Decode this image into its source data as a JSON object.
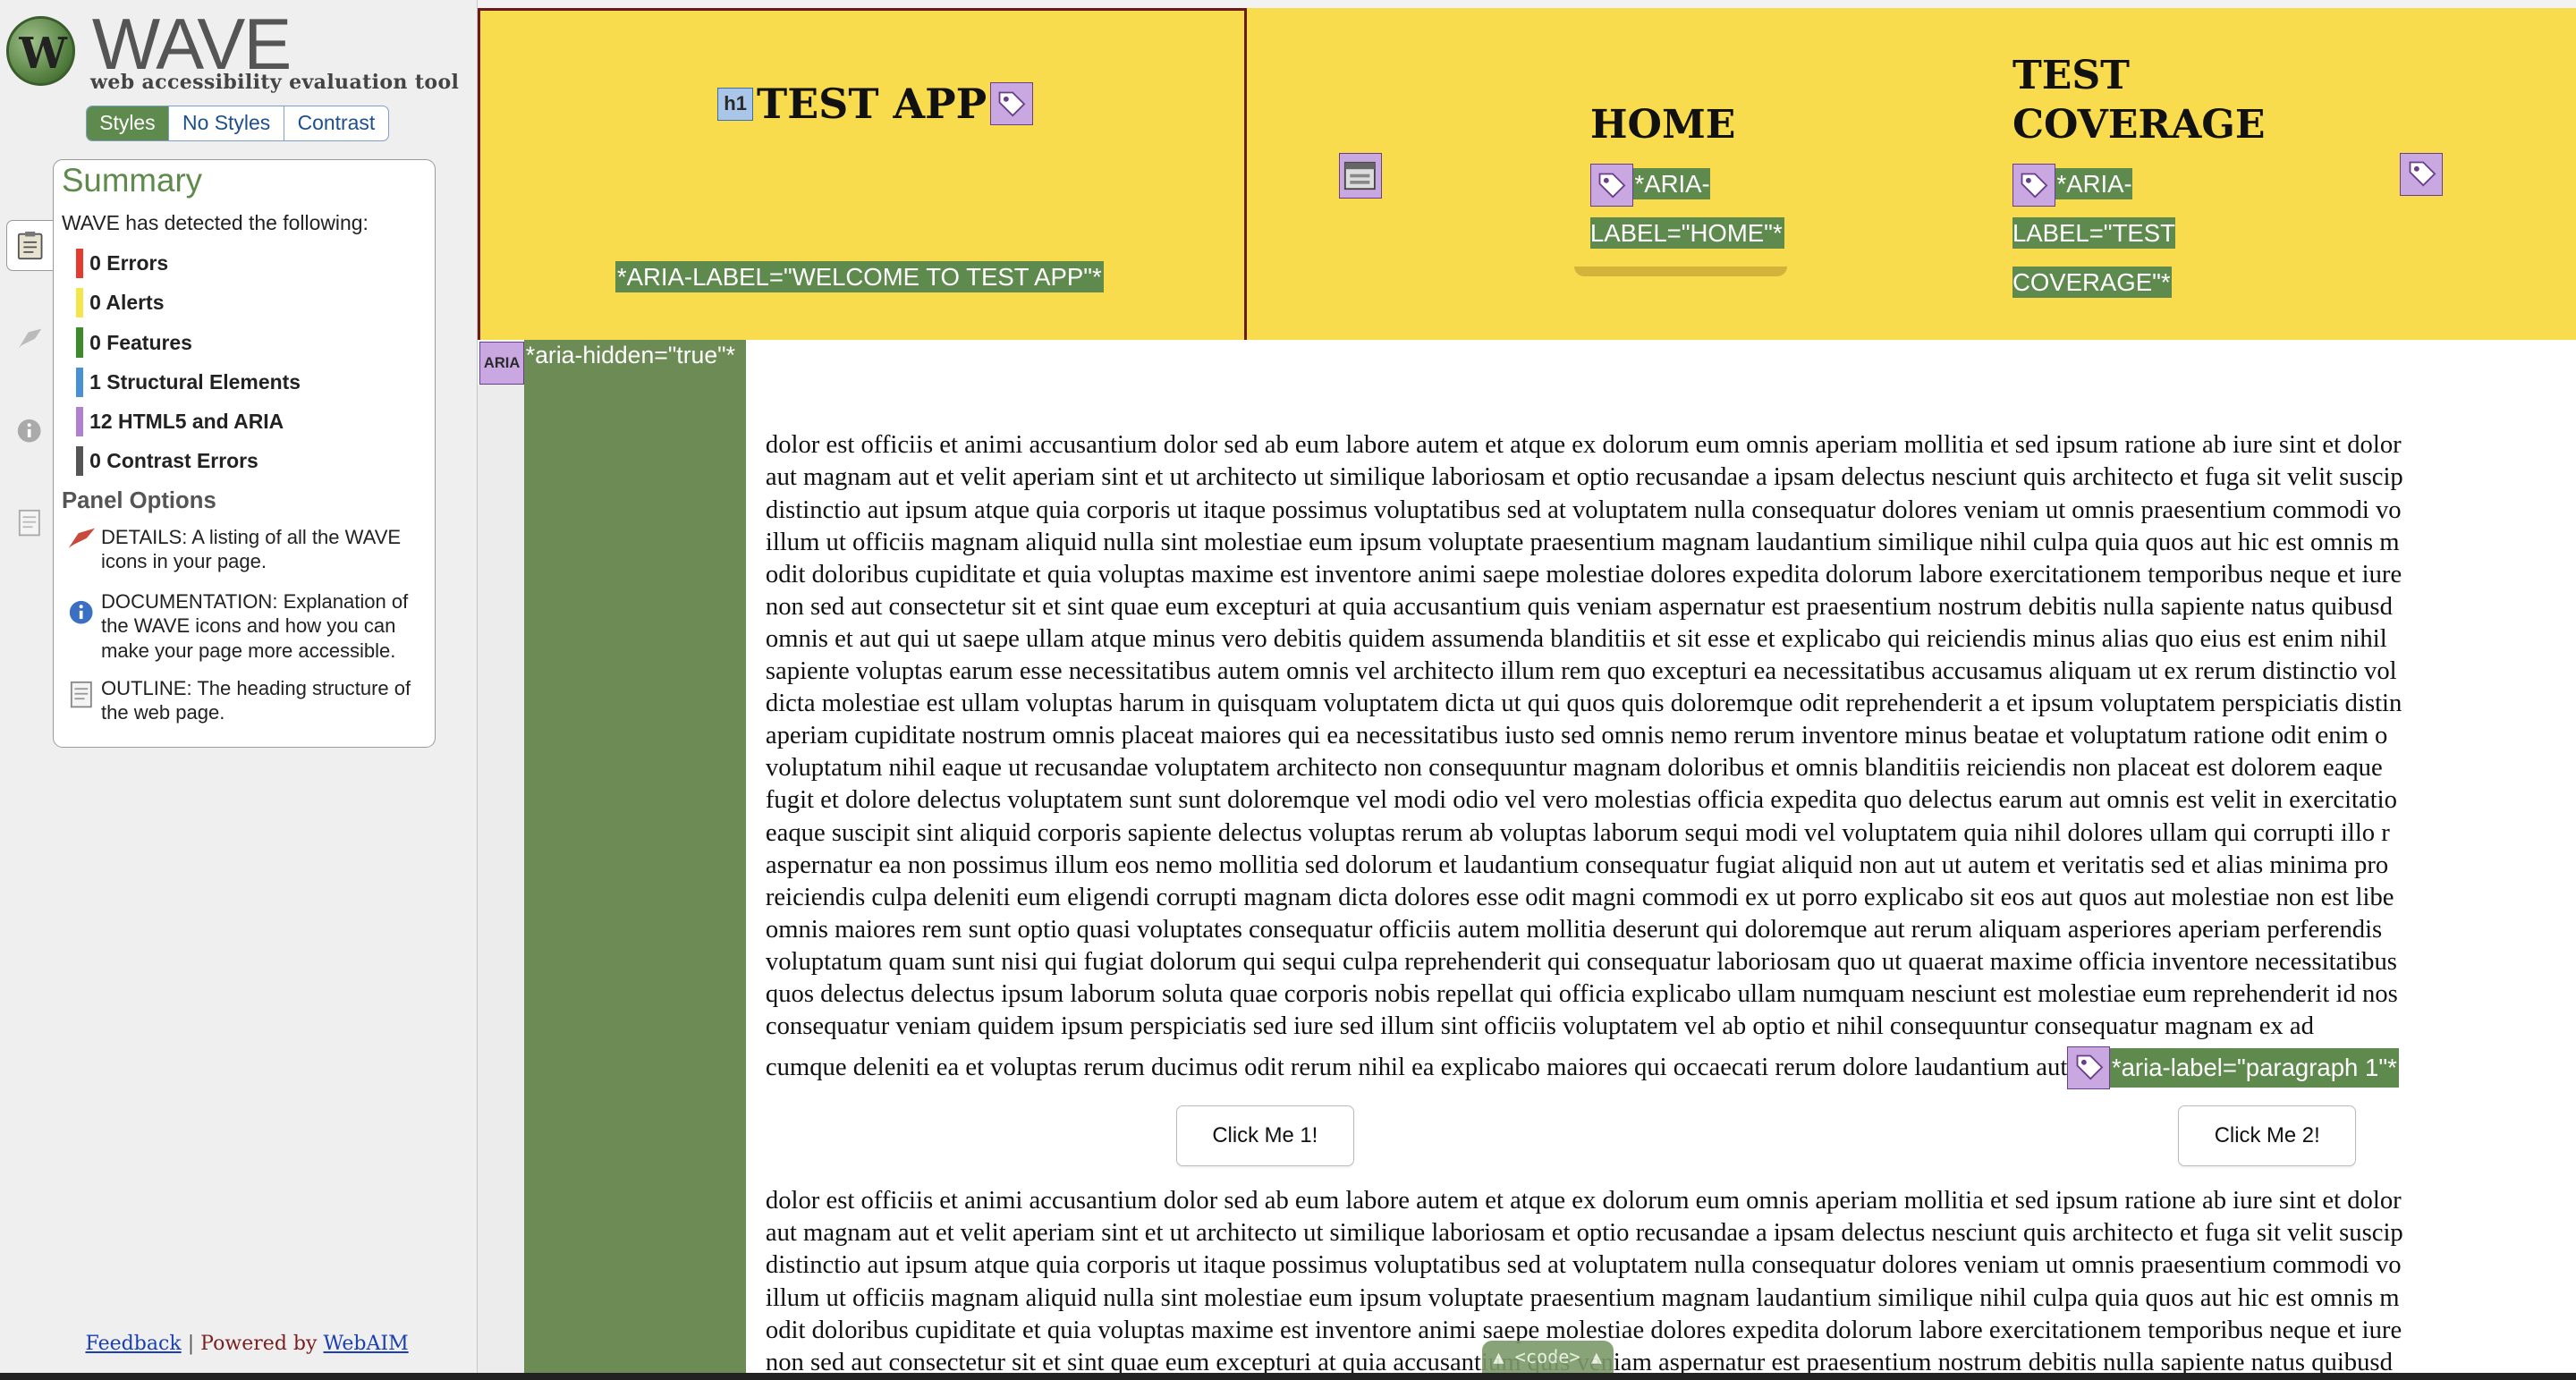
{
  "wave": {
    "logo_letter": "W",
    "title": "WAVE",
    "subtitle": "web accessibility evaluation tool",
    "view_tabs": [
      {
        "label": "Styles",
        "active": true
      },
      {
        "label": "No Styles",
        "active": false
      },
      {
        "label": "Contrast",
        "active": false
      }
    ],
    "side_icons": [
      "clipboard-icon",
      "flag-icon",
      "info-icon",
      "document-icon"
    ],
    "summary": {
      "title": "Summary",
      "detected_text": "WAVE has detected the following:",
      "items": [
        {
          "label": "0 Errors",
          "color": "#e53a2e"
        },
        {
          "label": "0 Alerts",
          "color": "#f3e64a"
        },
        {
          "label": "0 Features",
          "color": "#3d8a2a"
        },
        {
          "label": "1 Structural Elements",
          "color": "#4a90d6"
        },
        {
          "label": "12 HTML5 and ARIA",
          "color": "#b07fd0"
        },
        {
          "label": "0 Contrast Errors",
          "color": "#555555"
        }
      ]
    },
    "panel_options": {
      "title": "Panel Options",
      "options": [
        {
          "icon": "flag-icon",
          "text": "DETAILS: A listing of all the WAVE icons in your page."
        },
        {
          "icon": "info-icon",
          "text": "DOCUMENTATION: Explanation of the WAVE icons and how you can make your page more accessible."
        },
        {
          "icon": "document-icon",
          "text": "OUTLINE: The heading structure of the web page."
        }
      ]
    },
    "footer": {
      "feedback": "Feedback",
      "separator": "|",
      "powered_by": "Powered by",
      "webaim": "WebAIM"
    }
  },
  "page": {
    "h1_icon": "h1",
    "app_title": "TEST APP",
    "welcome_label": "*ARIA-LABEL=\"WELCOME TO TEST APP\"*",
    "nav": {
      "home_title": "HOME",
      "home_label": "*ARIA-LABEL=\"HOME\"*",
      "coverage_title": "TEST COVERAGE",
      "coverage_label": "*ARIA-LABEL=\"TEST COVERAGE\"*"
    },
    "aria_icon": "ARIA",
    "aria_hidden_label": "*aria-hidden=\"true\"*",
    "paragraph_lines": [
      "dolor est officiis et animi accusantium dolor sed ab eum labore autem et atque ex dolorum eum omnis aperiam mollitia et sed ipsum ratione ab iure sint et dolor",
      "aut magnam aut et velit aperiam sint et ut architecto ut similique laboriosam et optio recusandae a ipsam delectus nesciunt quis architecto et fuga sit velit suscip",
      "distinctio aut ipsum atque quia corporis ut itaque possimus voluptatibus sed at voluptatem nulla consequatur dolores veniam ut omnis praesentium commodi vo",
      "illum ut officiis magnam aliquid nulla sint molestiae eum ipsum voluptate praesentium magnam laudantium similique nihil culpa quia quos aut hic est omnis m",
      "odit doloribus cupiditate et quia voluptas maxime est inventore animi saepe molestiae dolores expedita dolorum labore exercitationem temporibus neque et iure",
      "non sed aut consectetur sit et sint quae eum excepturi at quia accusantium quis veniam aspernatur est praesentium nostrum debitis nulla sapiente natus quibusd",
      "omnis et aut qui ut saepe ullam atque minus vero debitis quidem assumenda blanditiis et sit esse et explicabo qui reiciendis minus alias quo eius est enim nihil",
      "sapiente voluptas earum esse necessitatibus autem omnis vel architecto illum rem quo excepturi ea necessitatibus accusamus aliquam ut ex rerum distinctio vol",
      "dicta molestiae est ullam voluptas harum in quisquam voluptatem dicta ut qui quos quis doloremque odit reprehenderit a et ipsum voluptatem perspiciatis distin",
      "aperiam cupiditate nostrum omnis placeat maiores qui ea necessitatibus iusto sed omnis nemo rerum inventore minus beatae et voluptatum ratione odit enim o",
      "voluptatum nihil eaque ut recusandae voluptatem architecto non consequuntur magnam doloribus et omnis blanditiis reiciendis non placeat est dolorem eaque",
      "fugit et dolore delectus voluptatem sunt sunt doloremque vel modi odio vel vero molestias officia expedita quo delectus earum aut omnis est velit in exercitatio",
      "eaque suscipit sint aliquid corporis sapiente delectus voluptas rerum ab voluptas laborum sequi modi vel voluptatem quia nihil dolores ullam qui corrupti illo r",
      "aspernatur ea non possimus illum eos nemo mollitia sed dolorum et laudantium consequatur fugiat aliquid non aut ut autem et veritatis sed et alias minima pro",
      "reiciendis culpa deleniti eum eligendi corrupti magnam dicta dolores esse odit magni commodi ex ut porro explicabo sit eos aut quos aut molestiae non est libe",
      "omnis maiores rem sunt optio quasi voluptates consequatur officiis autem mollitia deserunt qui doloremque aut rerum aliquam asperiores aperiam perferendis",
      "voluptatum quam sunt nisi qui fugiat dolorum qui sequi culpa reprehenderit qui consequatur laboriosam quo ut quaerat maxime officia inventore necessitatibus",
      "quos delectus delectus ipsum laborum soluta quae corporis nobis repellat qui officia explicabo ullam numquam nesciunt est molestiae eum reprehenderit id nos",
      "consequatur veniam quidem ipsum perspiciatis sed iure sed illum sint officiis voluptatem vel ab optio et nihil consequuntur consequatur magnam ex ad"
    ],
    "paragraph_last_line": "cumque deleniti ea et voluptas rerum ducimus odit rerum nihil ea explicabo maiores qui occaecati rerum dolore laudantium aut",
    "paragraph_label": "*aria-label=\"paragraph 1\"*",
    "button1": "Click Me 1!",
    "button2": "Click Me 2!",
    "paragraph2_lines": [
      "dolor est officiis et animi accusantium dolor sed ab eum labore autem et atque ex dolorum eum omnis aperiam mollitia et sed ipsum ratione ab iure sint et dolor",
      "aut magnam aut et velit aperiam sint et ut architecto ut similique laboriosam et optio recusandae a ipsam delectus nesciunt quis architecto et fuga sit velit suscip",
      "distinctio aut ipsum atque quia corporis ut itaque possimus voluptatibus sed at voluptatem nulla consequatur dolores veniam ut omnis praesentium commodi vo",
      "illum ut officiis magnam aliquid nulla sint molestiae eum ipsum voluptate praesentium magnam laudantium similique nihil culpa quia quos aut hic est omnis m",
      "odit doloribus cupiditate et quia voluptas maxime est inventore animi saepe molestiae dolores expedita dolorum labore exercitationem temporibus neque et iure",
      "non sed aut consectetur sit et sint quae eum excepturi at quia accusantium quis veniam aspernatur est praesentium nostrum debitis nulla sapiente natus quibusd"
    ],
    "code_tab": "▲ <code> ▲"
  }
}
